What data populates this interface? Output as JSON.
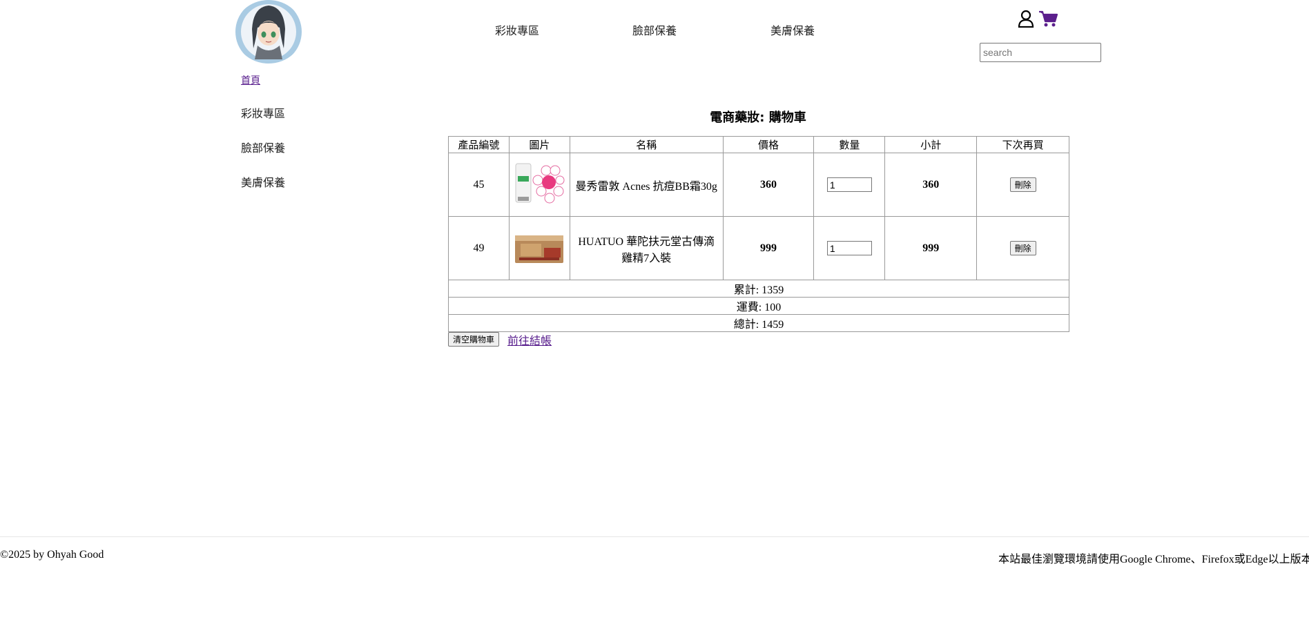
{
  "header": {
    "nav": [
      "彩妝專區",
      "臉部保養",
      "美膚保養"
    ],
    "search_placeholder": "search",
    "cart_color": "#5b1f8c"
  },
  "sidebar": {
    "home_label": "首頁",
    "items": [
      "彩妝專區",
      "臉部保養",
      "美膚保養"
    ]
  },
  "main": {
    "title": "電商藥妝: 購物車",
    "columns": [
      "產品編號",
      "圖片",
      "名稱",
      "價格",
      "數量",
      "小計",
      "下次再買"
    ],
    "rows": [
      {
        "id": "45",
        "name": "曼秀雷敦 Acnes 抗痘BB霜30g",
        "price": "360",
        "qty": "1",
        "subtotal": "360",
        "action": "刪除"
      },
      {
        "id": "49",
        "name": "HUATUO 華陀扶元堂古傳滴雞精7入裝",
        "price": "999",
        "qty": "1",
        "subtotal": "999",
        "action": "刪除"
      }
    ],
    "sum_line": "累計: 1359",
    "shipping_line": "運費: 100",
    "total_line": "總計: 1459",
    "clear_label": "清空購物車",
    "checkout_label": "前往結帳"
  },
  "footer": {
    "copyright": "©2025 by Ohyah Good",
    "browser_note": "本站最佳瀏覽環境請使用Google Chrome、Firefox或Edge以上版本"
  }
}
